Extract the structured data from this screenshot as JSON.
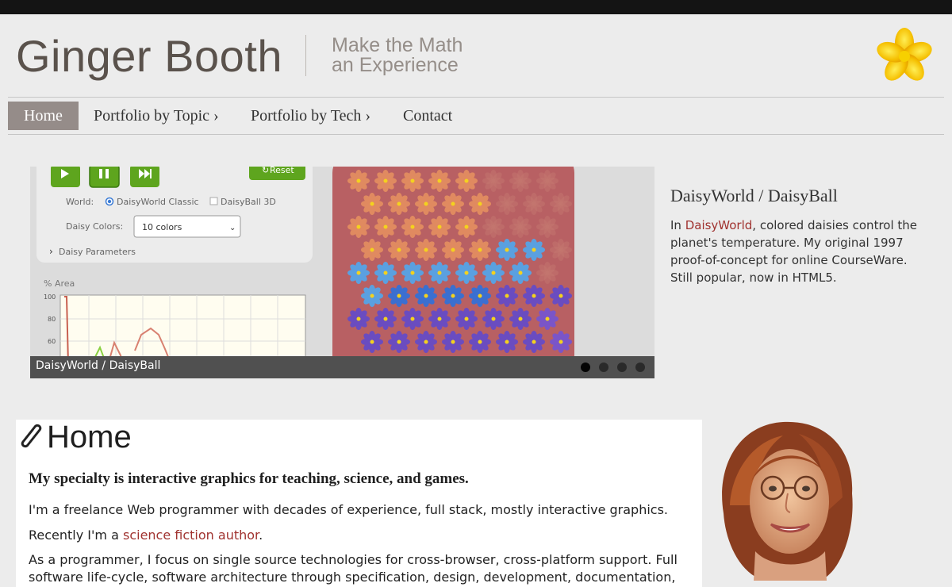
{
  "header": {
    "site_title": "Ginger Booth",
    "tagline_line1": "Make the Math",
    "tagline_line2": "an Experience",
    "logo_icon": "yellow-flower-icon"
  },
  "nav": {
    "items": [
      {
        "label": "Home",
        "active": true
      },
      {
        "label": "Portfolio by Topic ›",
        "active": false
      },
      {
        "label": "Portfolio by Tech ›",
        "active": false
      },
      {
        "label": "Contact",
        "active": false
      }
    ]
  },
  "slider": {
    "caption": "DaisyWorld / DaisyBall",
    "slide_count": 4,
    "active_index": 0,
    "app": {
      "reset_label": "Reset",
      "world_label": "World:",
      "world_option_1": "DaisyWorld Classic",
      "world_option_2": "DaisyBall 3D",
      "colors_label": "Daisy Colors:",
      "colors_value": "10 colors",
      "params_label": "Daisy Parameters",
      "chart_label": "% Area",
      "ticks": [
        "100",
        "80",
        "60"
      ]
    }
  },
  "feature": {
    "title": "DaisyWorld / DaisyBall",
    "desc_prefix": "In ",
    "desc_link": "DaisyWorld",
    "desc_rest": ", colored daisies control the planet's temperature. My original 1997 proof-of-concept for online CourseWare. Still popular, now in HTML5."
  },
  "main": {
    "heading": "Home",
    "specialty": "My specialty is interactive graphics for teaching, science, and games.",
    "para1": "I'm a freelance Web programmer with decades of experience, full stack, mostly interactive graphics.",
    "para2_prefix": "Recently I'm a ",
    "para2_link": "science fiction author",
    "para2_suffix": ".",
    "para3": "As a programmer, I focus on single source technologies for cross-browser, cross-platform support. Full software life-cycle, software architecture through specification, design, development, documentation,"
  },
  "colors": {
    "accent": "#a0322f",
    "nav_active": "#958c89",
    "planet": "#b86063",
    "button_green": "#5ea51e"
  }
}
